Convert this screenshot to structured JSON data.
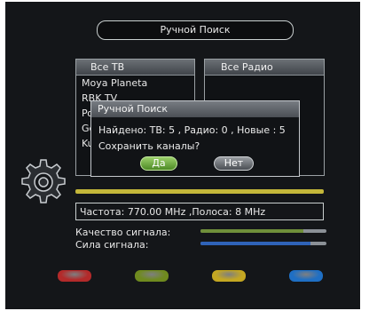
{
  "title": "Ручной Поиск",
  "tv_list": {
    "header": "Все ТВ",
    "channels": [
      "Moya Planeta",
      "RBK TV",
      "Po",
      "Ge",
      "Ku"
    ]
  },
  "radio_list": {
    "header": "Все Радио"
  },
  "dialog": {
    "title": "Ручной Поиск",
    "found_line": "Найдено: ТВ: 5 ,  Радио: 0 ,  Новые :  5",
    "question": "Сохранить каналы?",
    "yes_label": "Да",
    "no_label": "Нет"
  },
  "scan_progress": {
    "value": 1.0,
    "color": "#c4b73a"
  },
  "frequency_text": "Частота: 770.00 MHz ,Полоса: 8 MHz",
  "signal_quality": {
    "label": "Качество сигнала:",
    "value": 0.82,
    "color": "#6f8f3a"
  },
  "signal_strength": {
    "label": "Сила сигнала:",
    "value": 0.87,
    "color": "#2f63b8"
  },
  "color_keys": [
    {
      "name": "red",
      "color": "#b32a2a"
    },
    {
      "name": "green",
      "color": "#6f8a1f"
    },
    {
      "name": "yellow",
      "color": "#c4a722"
    },
    {
      "name": "blue",
      "color": "#1f6fc4"
    }
  ]
}
